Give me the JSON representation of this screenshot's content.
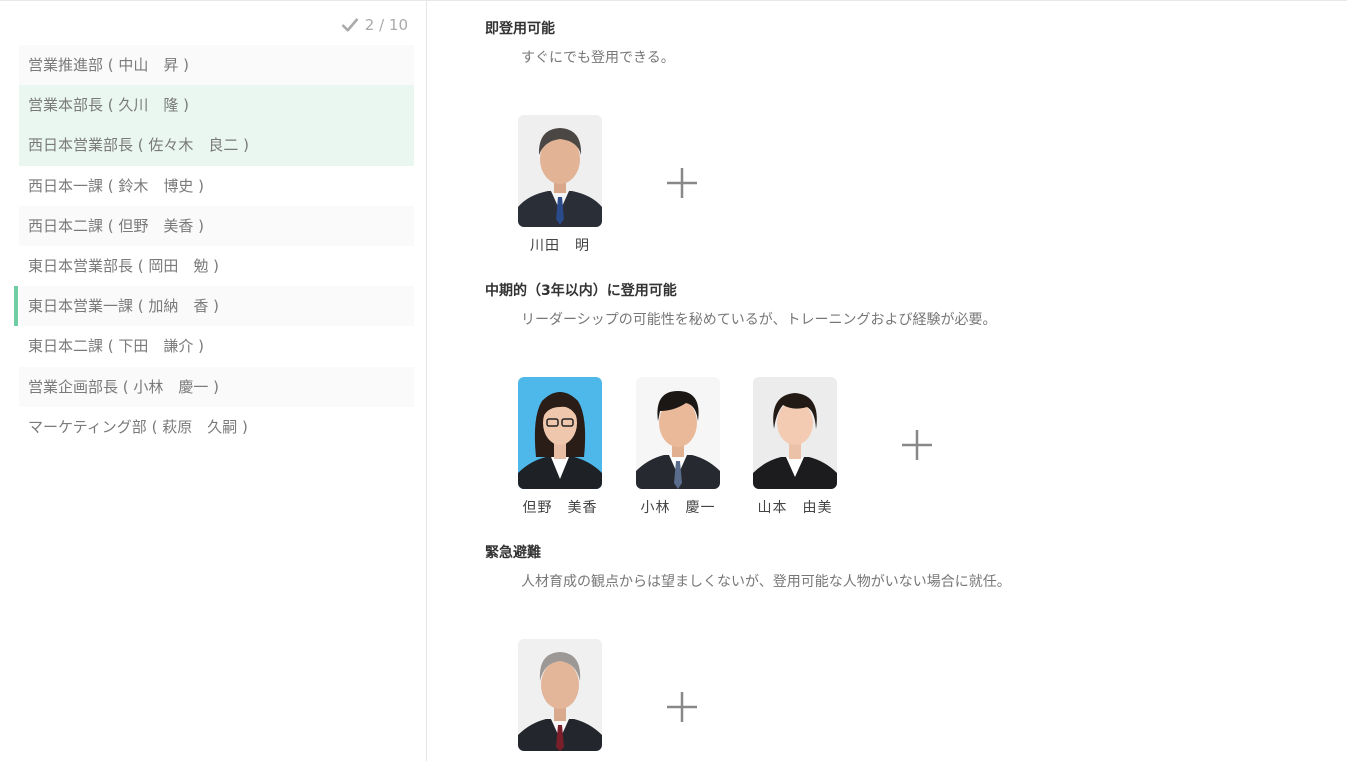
{
  "progress": {
    "text": "2 / 10",
    "icon": "check-icon",
    "color": "#aaaaaa"
  },
  "accent": "#6fcca3",
  "sidebar": {
    "items": [
      {
        "label": "営業推進部 ( 中山　昇 )",
        "state": "alt"
      },
      {
        "label": "営業本部長 ( 久川　隆 )",
        "state": "done"
      },
      {
        "label": "西日本営業部長 ( 佐々木　良二 )",
        "state": "done"
      },
      {
        "label": "西日本一課 ( 鈴木　博史 )",
        "state": "none"
      },
      {
        "label": "西日本二課 ( 但野　美香 )",
        "state": "alt"
      },
      {
        "label": "東日本営業部長 ( 岡田　勉 )",
        "state": "none"
      },
      {
        "label": "東日本営業一課 ( 加納　香 )",
        "state": "current"
      },
      {
        "label": "東日本二課 ( 下田　謙介 )",
        "state": "none"
      },
      {
        "label": "営業企画部長 ( 小林　慶一 )",
        "state": "alt"
      },
      {
        "label": "マーケティング部 ( 萩原　久嗣 )",
        "state": "none"
      }
    ]
  },
  "sections": [
    {
      "title": "即登用可能",
      "description": "すぐにでも登用できる。",
      "people": [
        {
          "name": "川田　明",
          "photo": "man-blue-tie-photo"
        }
      ],
      "add_icon": "plus-icon"
    },
    {
      "title": "中期的（3年以内）に登用可能",
      "description": "リーダーシップの可能性を秘めているが、トレーニングおよび経験が必要。",
      "people": [
        {
          "name": "但野　美香",
          "photo": "woman-glasses-photo"
        },
        {
          "name": "小林　慶一",
          "photo": "young-man-photo"
        },
        {
          "name": "山本　由美",
          "photo": "woman-short-hair-photo"
        }
      ],
      "add_icon": "plus-icon"
    },
    {
      "title": "緊急避難",
      "description": "人材育成の観点からは望ましくないが、登用可能な人物がいない場合に就任。",
      "people": [
        {
          "name": "",
          "photo": "senior-man-photo"
        }
      ],
      "add_icon": "plus-icon"
    }
  ]
}
